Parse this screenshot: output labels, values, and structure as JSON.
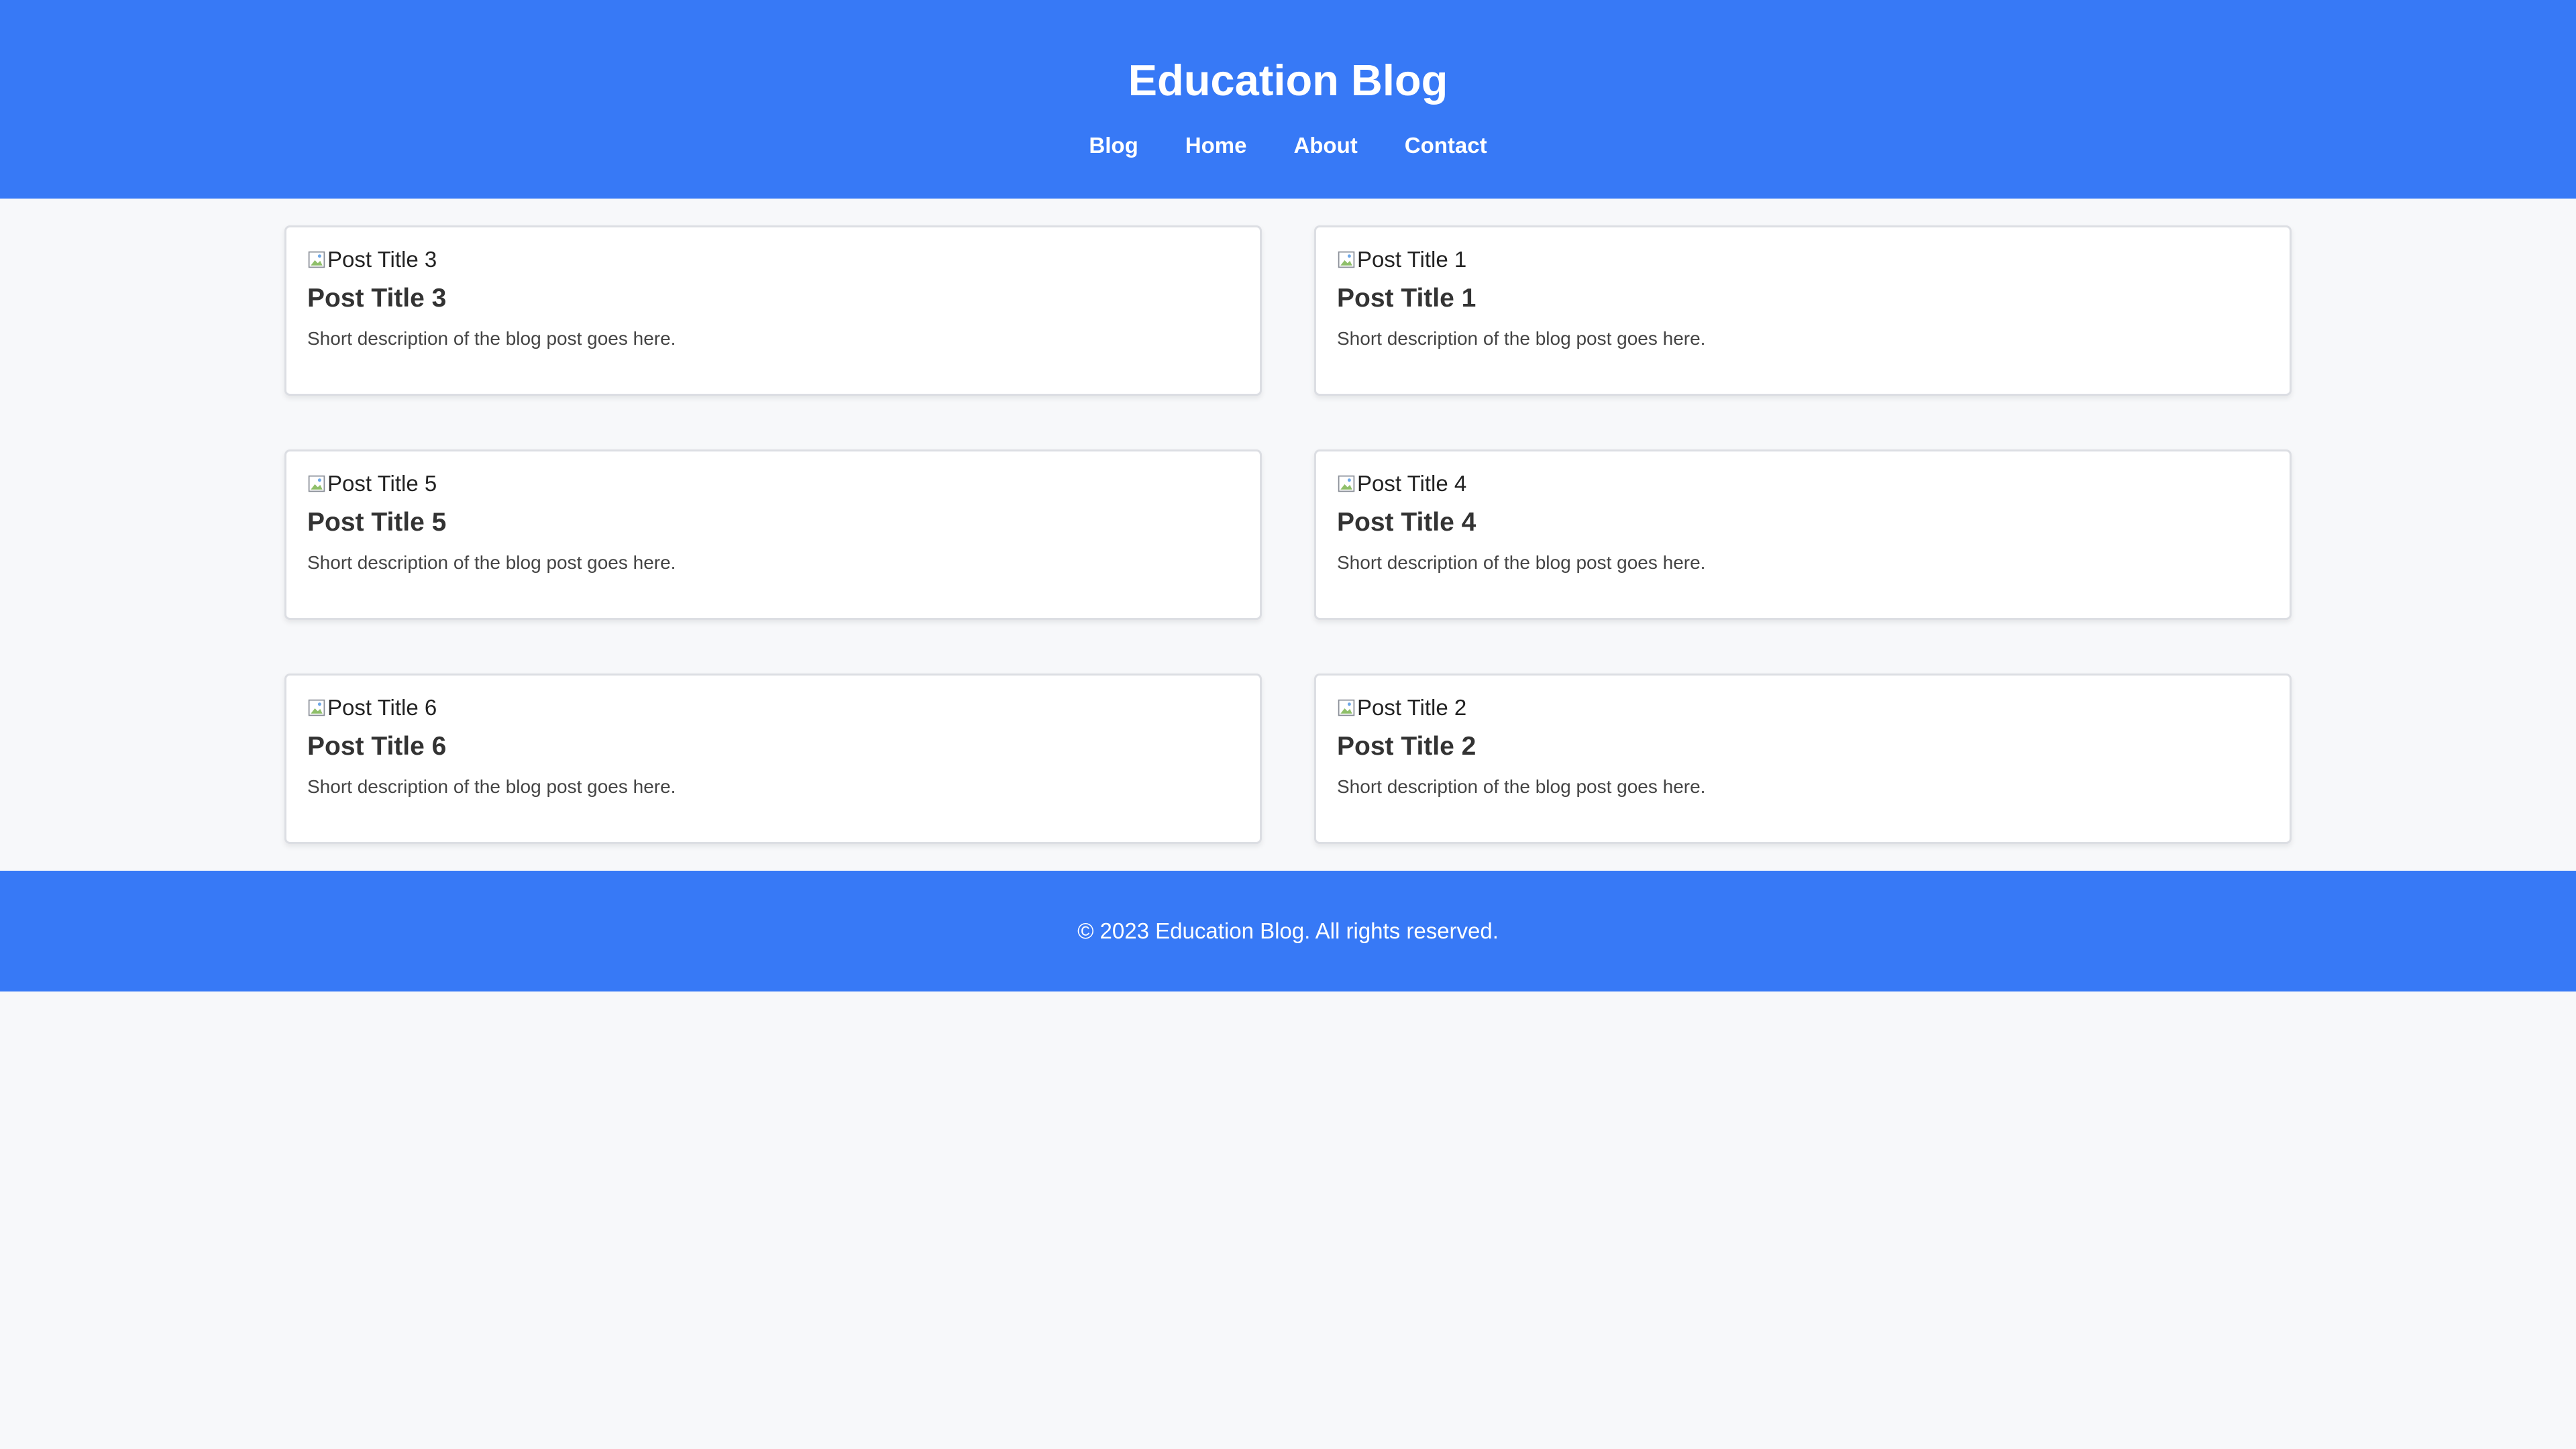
{
  "colors": {
    "primary": "#3779f6",
    "background": "#f7f8fa",
    "card_background": "#ffffff",
    "text": "#333333"
  },
  "header": {
    "title": "Education Blog",
    "nav": [
      "Blog",
      "Home",
      "About",
      "Contact"
    ]
  },
  "posts": [
    {
      "image_alt": "Post Title 3",
      "title": "Post Title 3",
      "description": "Short description of the blog post goes here."
    },
    {
      "image_alt": "Post Title 1",
      "title": "Post Title 1",
      "description": "Short description of the blog post goes here."
    },
    {
      "image_alt": "Post Title 5",
      "title": "Post Title 5",
      "description": "Short description of the blog post goes here."
    },
    {
      "image_alt": "Post Title 4",
      "title": "Post Title 4",
      "description": "Short description of the blog post goes here."
    },
    {
      "image_alt": "Post Title 6",
      "title": "Post Title 6",
      "description": "Short description of the blog post goes here."
    },
    {
      "image_alt": "Post Title 2",
      "title": "Post Title 2",
      "description": "Short description of the blog post goes here."
    }
  ],
  "icons": {
    "post_image": "broken-image-icon"
  },
  "footer": {
    "text": "© 2023 Education Blog. All rights reserved."
  }
}
